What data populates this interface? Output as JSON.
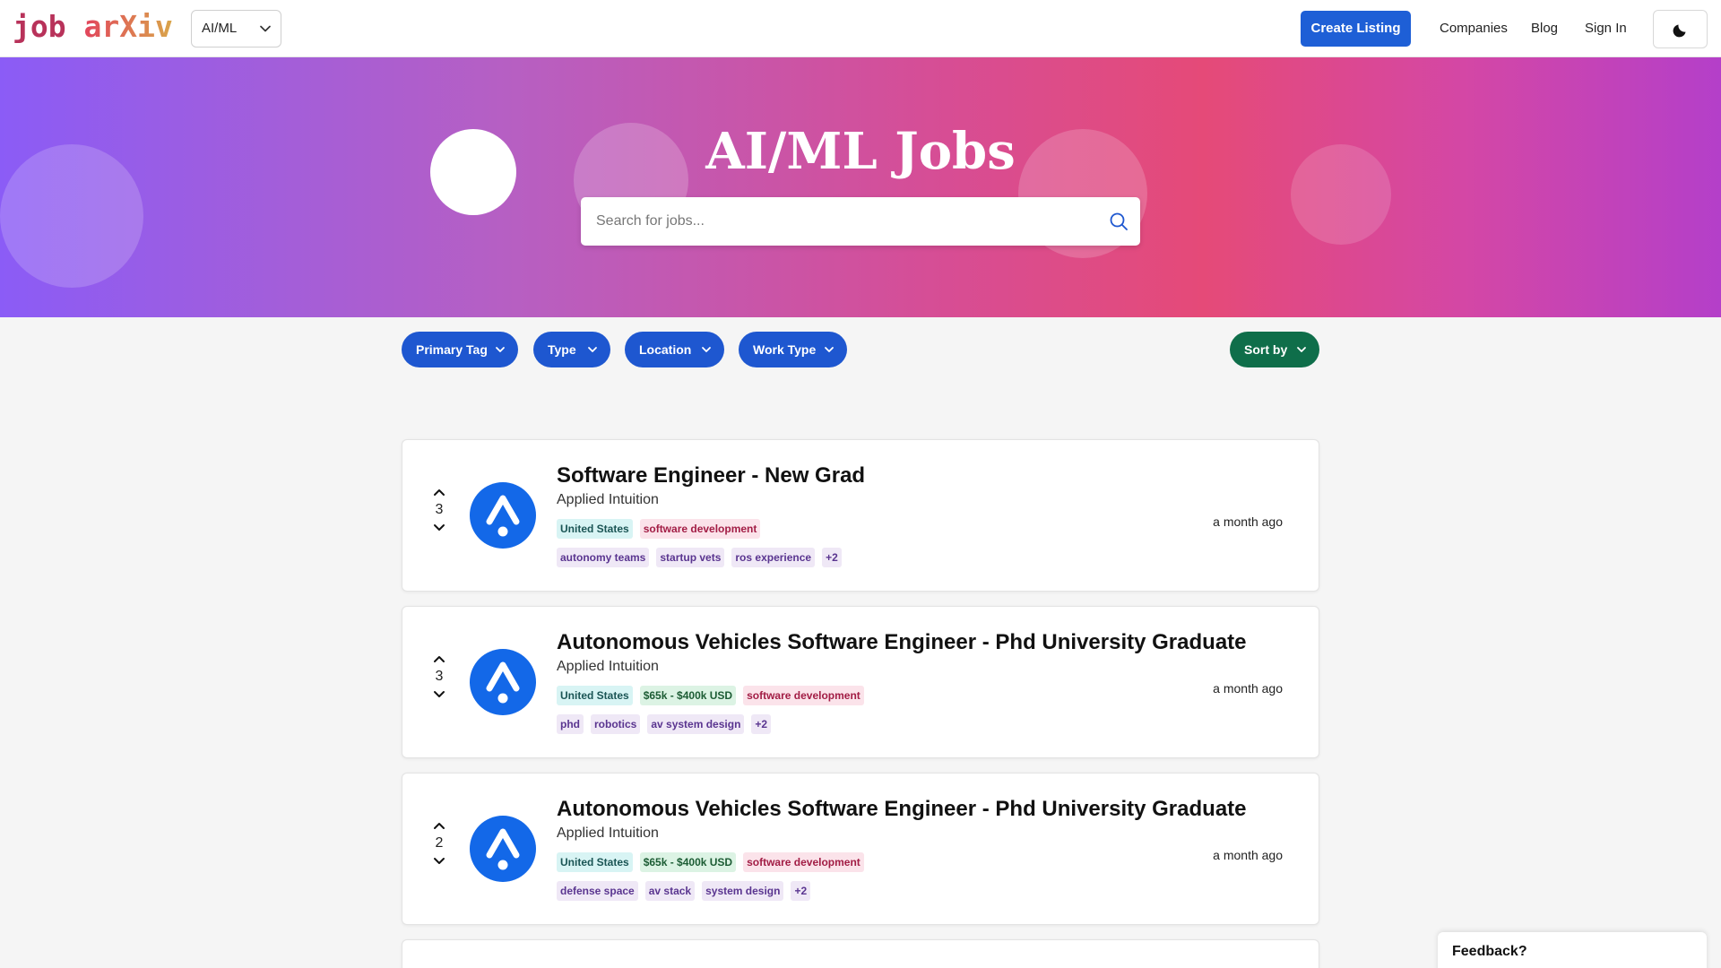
{
  "header": {
    "logo_part1": "job",
    "logo_part2": "arXiv",
    "category_selected": "AI/ML",
    "create_listing": "Create Listing",
    "nav": [
      "Companies",
      "Blog",
      "Sign In"
    ]
  },
  "hero": {
    "title": "AI/ML Jobs",
    "search_placeholder": "Search for jobs..."
  },
  "filters": {
    "chips": [
      "Primary Tag",
      "Type",
      "Location",
      "Work Type"
    ],
    "sort": "Sort by"
  },
  "jobs": [
    {
      "votes": "3",
      "title": "Software Engineer - New Grad",
      "company": "Applied Intuition",
      "location": "United States",
      "category": "software development",
      "keywords": [
        "autonomy teams",
        "startup vets",
        "ros experience",
        "+2"
      ],
      "posted": "a month ago"
    },
    {
      "votes": "3",
      "title": "Autonomous Vehicles Software Engineer - Phd University Graduate",
      "company": "Applied Intuition",
      "location": "United States",
      "salary": "$65k - $400k USD",
      "category": "software development",
      "keywords": [
        "phd",
        "robotics",
        "av system design",
        "+2"
      ],
      "posted": "a month ago"
    },
    {
      "votes": "2",
      "title": "Autonomous Vehicles Software Engineer - Phd University Graduate",
      "company": "Applied Intuition",
      "location": "United States",
      "salary": "$65k - $400k USD",
      "category": "software development",
      "keywords": [
        "defense space",
        "av stack",
        "system design",
        "+2"
      ],
      "posted": "a month ago"
    }
  ],
  "feedback": "Feedback?",
  "colors": {
    "primary": "#1e57d0",
    "sort": "#0f6e4a",
    "logo_accent": "#b8325a"
  }
}
